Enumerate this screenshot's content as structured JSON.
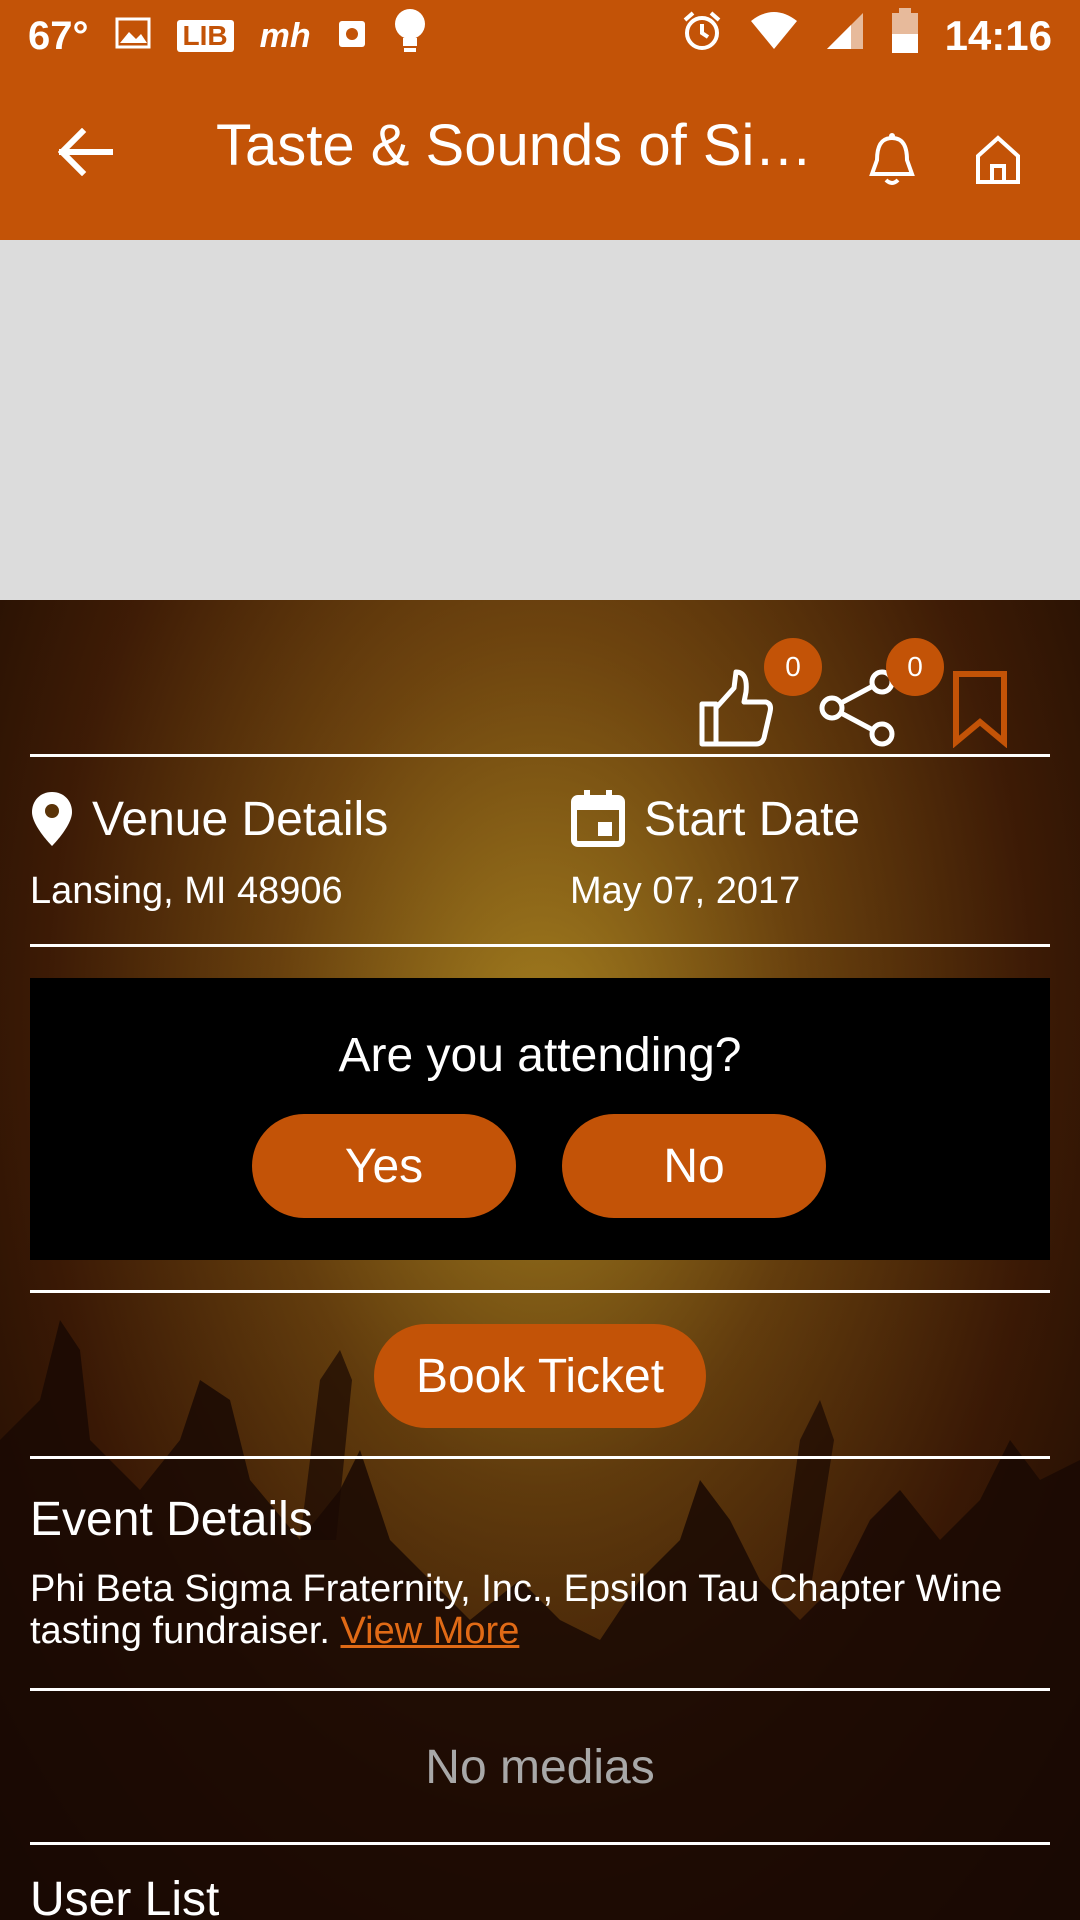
{
  "status_bar": {
    "temperature": "67°",
    "icons": [
      "image-icon",
      "lib-icon",
      "mh-icon",
      "square-icon",
      "bulb-icon"
    ],
    "right_icons": [
      "alarm-icon",
      "wifi-icon",
      "signal-icon",
      "battery-icon"
    ],
    "lib_label": "LIB",
    "mh_label": "mh",
    "time": "14:16"
  },
  "app_bar": {
    "title": "Taste & Sounds of Si…",
    "back_icon": "arrow-left-icon",
    "bell_icon": "bell-icon",
    "home_icon": "home-icon",
    "color": "#c35307"
  },
  "actions": {
    "like_count": "0",
    "share_count": "0"
  },
  "venue": {
    "label": "Venue Details",
    "value": "Lansing, MI 48906"
  },
  "start_date": {
    "label": "Start Date",
    "value": "May 07, 2017"
  },
  "attending": {
    "question": "Are you attending?",
    "yes_label": "Yes",
    "no_label": "No"
  },
  "book_ticket_label": "Book Ticket",
  "event_details": {
    "title": "Event Details",
    "text": "Phi Beta Sigma Fraternity, Inc., Epsilon Tau Chapter Wine tasting fundraiser. ",
    "view_more": "View More"
  },
  "media": {
    "empty_text": "No medias"
  },
  "user_list_title": "User List"
}
